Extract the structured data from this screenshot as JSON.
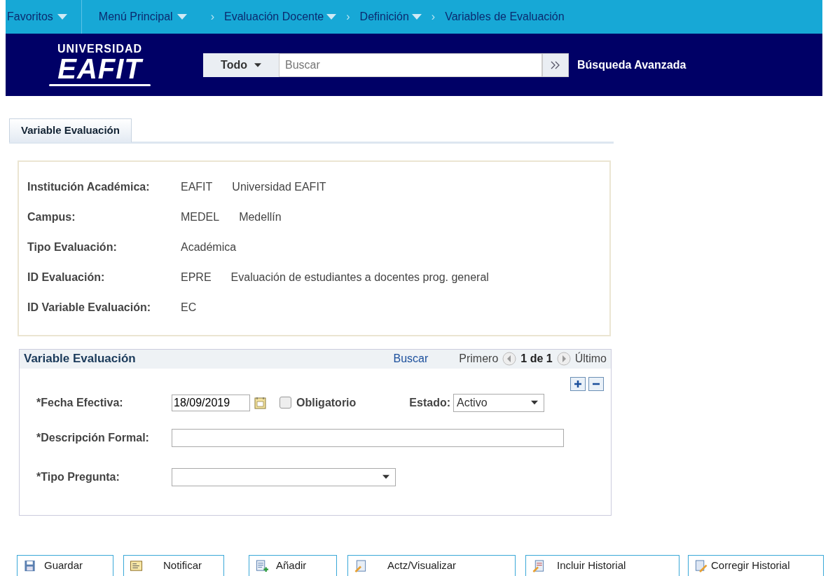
{
  "top_menu": {
    "items": [
      {
        "label": "Favoritos",
        "dropdown": true
      },
      {
        "label": "Menú Principal",
        "dropdown": true
      }
    ],
    "breadcrumb": [
      {
        "separator": "›",
        "label": "Evaluación Docente",
        "dropdown": true
      },
      {
        "separator": "›",
        "label": "Definición",
        "dropdown": true
      },
      {
        "separator": "›",
        "label": "Variables de Evaluación",
        "dropdown": false
      }
    ]
  },
  "header": {
    "logo": {
      "line1": "UNIVERSIDAD",
      "line2": "EAFIT"
    },
    "search": {
      "scope": "Todo",
      "placeholder": "Buscar"
    },
    "advanced_search": "Búsqueda Avanzada"
  },
  "tabs": [
    {
      "label": "Variable Evaluación",
      "selected": true
    }
  ],
  "key_fields": [
    {
      "label": "Institución Académica:",
      "code": "EAFIT",
      "description": "Universidad EAFIT"
    },
    {
      "label": "Campus:",
      "code": "MEDEL",
      "description": "Medellín"
    },
    {
      "label": "Tipo Evaluación:",
      "code": "Académica"
    },
    {
      "label": "ID Evaluación:",
      "code": "EPRE",
      "description": "Evaluación de estudiantes a docentes prog. general"
    },
    {
      "label": "ID Variable Evaluación:",
      "code": "EC"
    }
  ],
  "grid": {
    "title": "Variable Evaluación",
    "find": "Buscar",
    "first": "Primero",
    "count": "1 de 1",
    "last": "Último",
    "effective_date": {
      "label": "*Fecha Efectiva:",
      "value": "18/09/2019"
    },
    "required": {
      "label": "Obligatorio",
      "checked": false
    },
    "status": {
      "label": "Estado:",
      "value": "Activo"
    },
    "description": {
      "label": "*Descripción Formal:"
    },
    "question_type": {
      "label": "*Tipo Pregunta:"
    }
  },
  "buttons": [
    {
      "label": "Guardar",
      "kind": "save"
    },
    {
      "label": "Notificar",
      "kind": "notify"
    },
    {
      "label": "Añadir",
      "kind": "add"
    },
    {
      "label": "Actz/Visualizar",
      "kind": "update"
    },
    {
      "label": "Incluir Historial",
      "kind": "history"
    },
    {
      "label": "Corregir Historial",
      "kind": "correct"
    }
  ]
}
